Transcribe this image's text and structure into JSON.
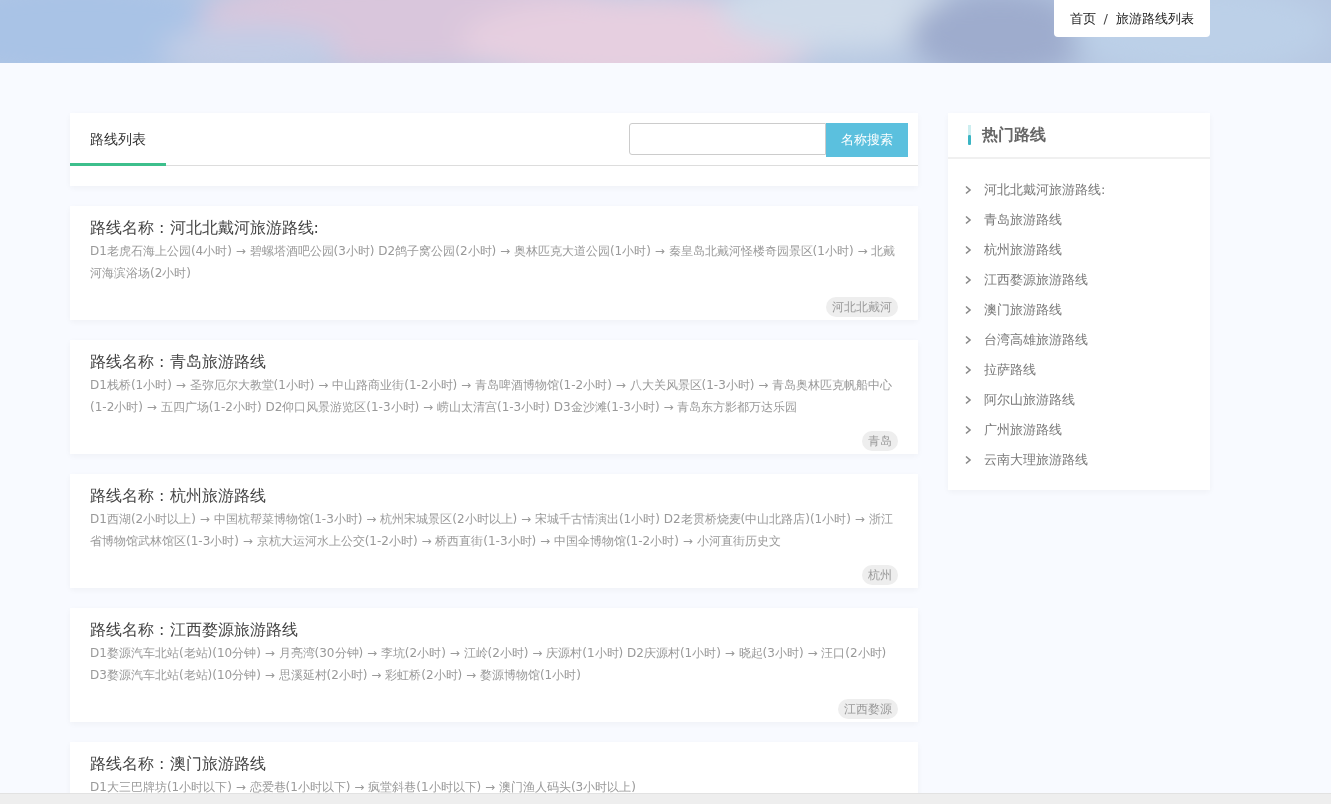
{
  "breadcrumb": [
    {
      "label": "首页"
    },
    {
      "label": "旅游路线列表"
    }
  ],
  "breadcrumb_separator": "/",
  "tabs": [
    {
      "label": "路线列表",
      "selected": true
    }
  ],
  "search": {
    "button": "名称搜索"
  },
  "routes": [
    {
      "title": "路线名称 : 河北北戴河旅游路线:",
      "description": "D1老虎石海上公园(4小时) → 碧螺塔酒吧公园(3小时) D2鸽子窝公园(2小时) → 奥林匹克大道公园(1小时) → 秦皇岛北戴河怪楼奇园景区(1小时) → 北戴河海滨浴场(2小时)",
      "tag": "河北北戴河"
    },
    {
      "title": "路线名称 : 青岛旅游路线",
      "description": "D1栈桥(1小时) → 圣弥厄尔大教堂(1小时) → 中山路商业街(1-2小时) → 青岛啤酒博物馆(1-2小时) → 八大关风景区(1-3小时) → 青岛奥林匹克帆船中心(1-2小时) → 五四广场(1-2小时) D2仰口风景游览区(1-3小时) → 崂山太清宫(1-3小时) D3金沙滩(1-3小时) → 青岛东方影都万达乐园",
      "tag": "青岛"
    },
    {
      "title": "路线名称 : 杭州旅游路线",
      "description": "D1西湖(2小时以上) → 中国杭帮菜博物馆(1-3小时) → 杭州宋城景区(2小时以上) → 宋城千古情演出(1小时) D2老贯桥烧麦(中山北路店)(1小时) → 浙江省博物馆武林馆区(1-3小时) → 京杭大运河水上公交(1-2小时) → 桥西直街(1-3小时) → 中国伞博物馆(1-2小时) → 小河直街历史文",
      "tag": "杭州"
    },
    {
      "title": "路线名称 : 江西婺源旅游路线",
      "description": "D1婺源汽车北站(老站)(10分钟) → 月亮湾(30分钟) → 李坑(2小时) → 江岭(2小时) → 庆源村(1小时) D2庆源村(1小时) → 晓起(3小时) → 汪口(2小时) D3婺源汽车北站(老站)(10分钟) → 思溪延村(2小时) → 彩虹桥(2小时) → 婺源博物馆(1小时)",
      "tag": "江西婺源"
    },
    {
      "title": "路线名称 : 澳门旅游路线",
      "description": "D1大三巴牌坊(1小时以下) → 恋爱巷(1小时以下) → 疯堂斜巷(1小时以下) → 澳门渔人码头(3小时以上)"
    }
  ],
  "hot_routes": {
    "title": "热门路线",
    "items": [
      "河北北戴河旅游路线:",
      "青岛旅游路线",
      "杭州旅游路线",
      "江西婺源旅游路线",
      "澳门旅游路线",
      "台湾高雄旅游路线",
      "拉萨路线",
      "阿尔山旅游路线",
      "广州旅游路线",
      "云南大理旅游路线"
    ]
  }
}
